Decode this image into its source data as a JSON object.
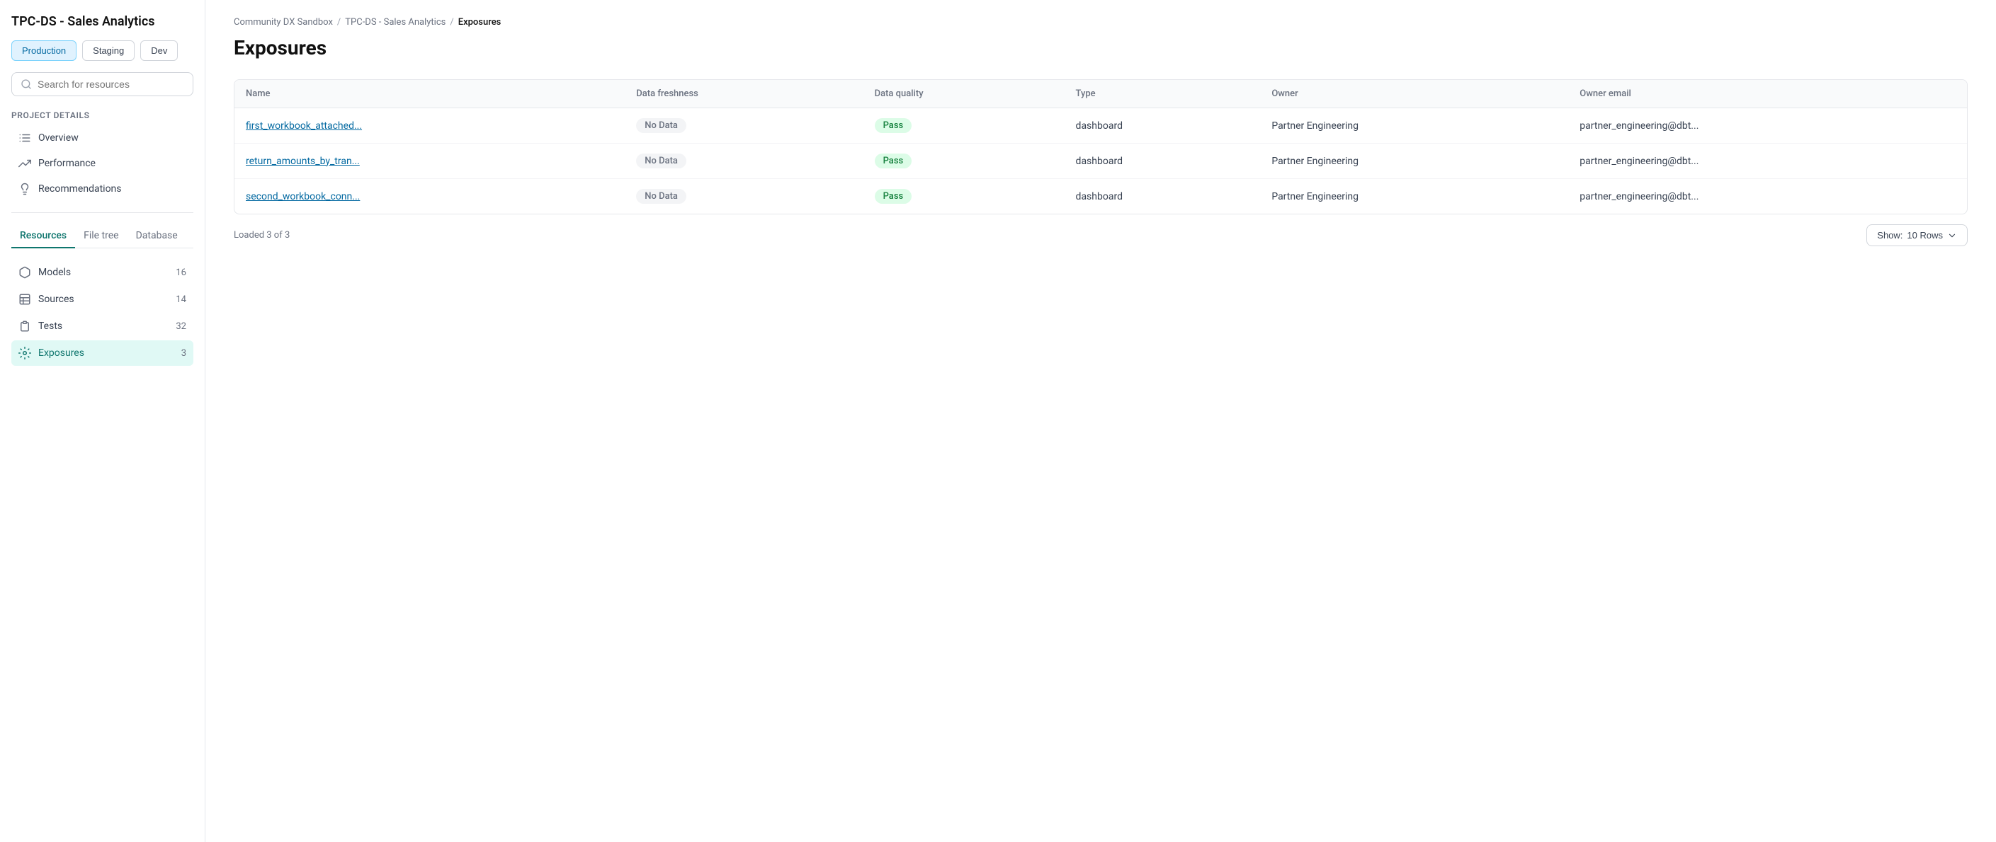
{
  "app": {
    "title": "TPC-DS - Sales Analytics"
  },
  "env_tabs": [
    {
      "label": "Production",
      "active": true
    },
    {
      "label": "Staging",
      "active": false
    },
    {
      "label": "Dev",
      "active": false
    }
  ],
  "search": {
    "placeholder": "Search for resources"
  },
  "project_details_label": "Project details",
  "nav_items": [
    {
      "label": "Overview",
      "icon": "list-icon"
    },
    {
      "label": "Performance",
      "icon": "chart-icon"
    },
    {
      "label": "Recommendations",
      "icon": "lightbulb-icon"
    }
  ],
  "tabs": [
    {
      "label": "Resources",
      "active": true
    },
    {
      "label": "File tree",
      "active": false
    },
    {
      "label": "Database",
      "active": false
    }
  ],
  "resources": [
    {
      "label": "Models",
      "icon": "cube-icon",
      "count": "16",
      "active": false
    },
    {
      "label": "Sources",
      "icon": "table-icon",
      "count": "14",
      "active": false
    },
    {
      "label": "Tests",
      "icon": "clipboard-icon",
      "count": "32",
      "active": false
    },
    {
      "label": "Exposures",
      "icon": "exposure-icon",
      "count": "3",
      "active": true
    }
  ],
  "breadcrumb": {
    "items": [
      {
        "label": "Community DX Sandbox"
      },
      {
        "label": "TPC-DS - Sales Analytics"
      },
      {
        "label": "Exposures",
        "current": true
      }
    ]
  },
  "page": {
    "title": "Exposures"
  },
  "table": {
    "columns": [
      {
        "label": "Name"
      },
      {
        "label": "Data freshness"
      },
      {
        "label": "Data quality"
      },
      {
        "label": "Type"
      },
      {
        "label": "Owner"
      },
      {
        "label": "Owner email"
      }
    ],
    "rows": [
      {
        "name": "first_workbook_attached...",
        "data_freshness": "No Data",
        "data_quality": "Pass",
        "type": "dashboard",
        "owner": "Partner Engineering",
        "owner_email": "partner_engineering@dbt..."
      },
      {
        "name": "return_amounts_by_tran...",
        "data_freshness": "No Data",
        "data_quality": "Pass",
        "type": "dashboard",
        "owner": "Partner Engineering",
        "owner_email": "partner_engineering@dbt..."
      },
      {
        "name": "second_workbook_conn...",
        "data_freshness": "No Data",
        "data_quality": "Pass",
        "type": "dashboard",
        "owner": "Partner Engineering",
        "owner_email": "partner_engineering@dbt..."
      }
    ]
  },
  "footer": {
    "loaded_text": "Loaded 3 of 3",
    "show_rows_label": "Show:",
    "show_rows_value": "10 Rows"
  }
}
